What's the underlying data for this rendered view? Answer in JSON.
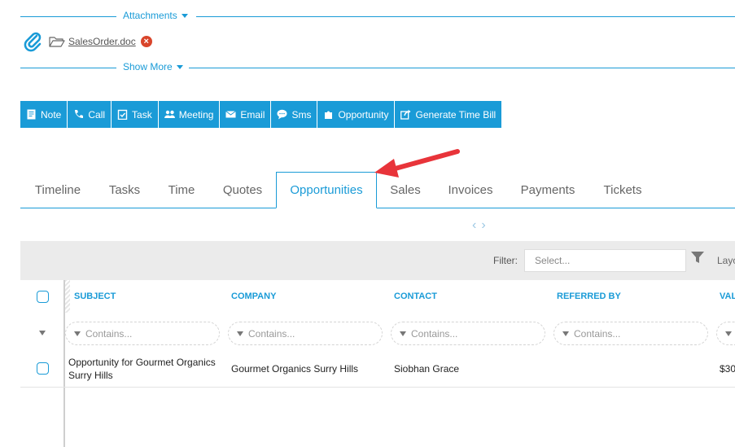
{
  "attachments": {
    "header_label": "Attachments",
    "file_name": "SalesOrder.doc",
    "show_more_label": "Show More"
  },
  "toolbar": {
    "buttons": [
      {
        "label": "Note",
        "icon": "note-icon"
      },
      {
        "label": "Call",
        "icon": "phone-icon"
      },
      {
        "label": "Task",
        "icon": "task-check-icon"
      },
      {
        "label": "Meeting",
        "icon": "people-icon"
      },
      {
        "label": "Email",
        "icon": "envelope-icon"
      },
      {
        "label": "Sms",
        "icon": "chat-bubble-icon"
      },
      {
        "label": "Opportunity",
        "icon": "puzzle-icon"
      },
      {
        "label": "Generate Time Bill",
        "icon": "share-icon"
      }
    ]
  },
  "tabs": {
    "items": [
      "Timeline",
      "Tasks",
      "Time",
      "Quotes",
      "Opportunities",
      "Sales",
      "Invoices",
      "Payments",
      "Tickets"
    ],
    "active": "Opportunities"
  },
  "filter": {
    "label": "Filter:",
    "placeholder": "Select...",
    "layout_label": "Layo"
  },
  "grid": {
    "columns": [
      "SUBJECT",
      "COMPANY",
      "CONTACT",
      "REFERRED BY",
      "VAL"
    ],
    "filter_placeholder": "Contains...",
    "rows": [
      {
        "subject_line1": "Opportunity for Gourmet Organics",
        "subject_line2": "Surry Hills",
        "company": "Gourmet Organics Surry Hills",
        "contact": "Siobhan Grace",
        "referred_by": "",
        "value": "$30"
      }
    ]
  },
  "colors": {
    "accent": "#1a9bd7",
    "annotation_arrow": "#e8343a",
    "remove": "#d9452b"
  }
}
